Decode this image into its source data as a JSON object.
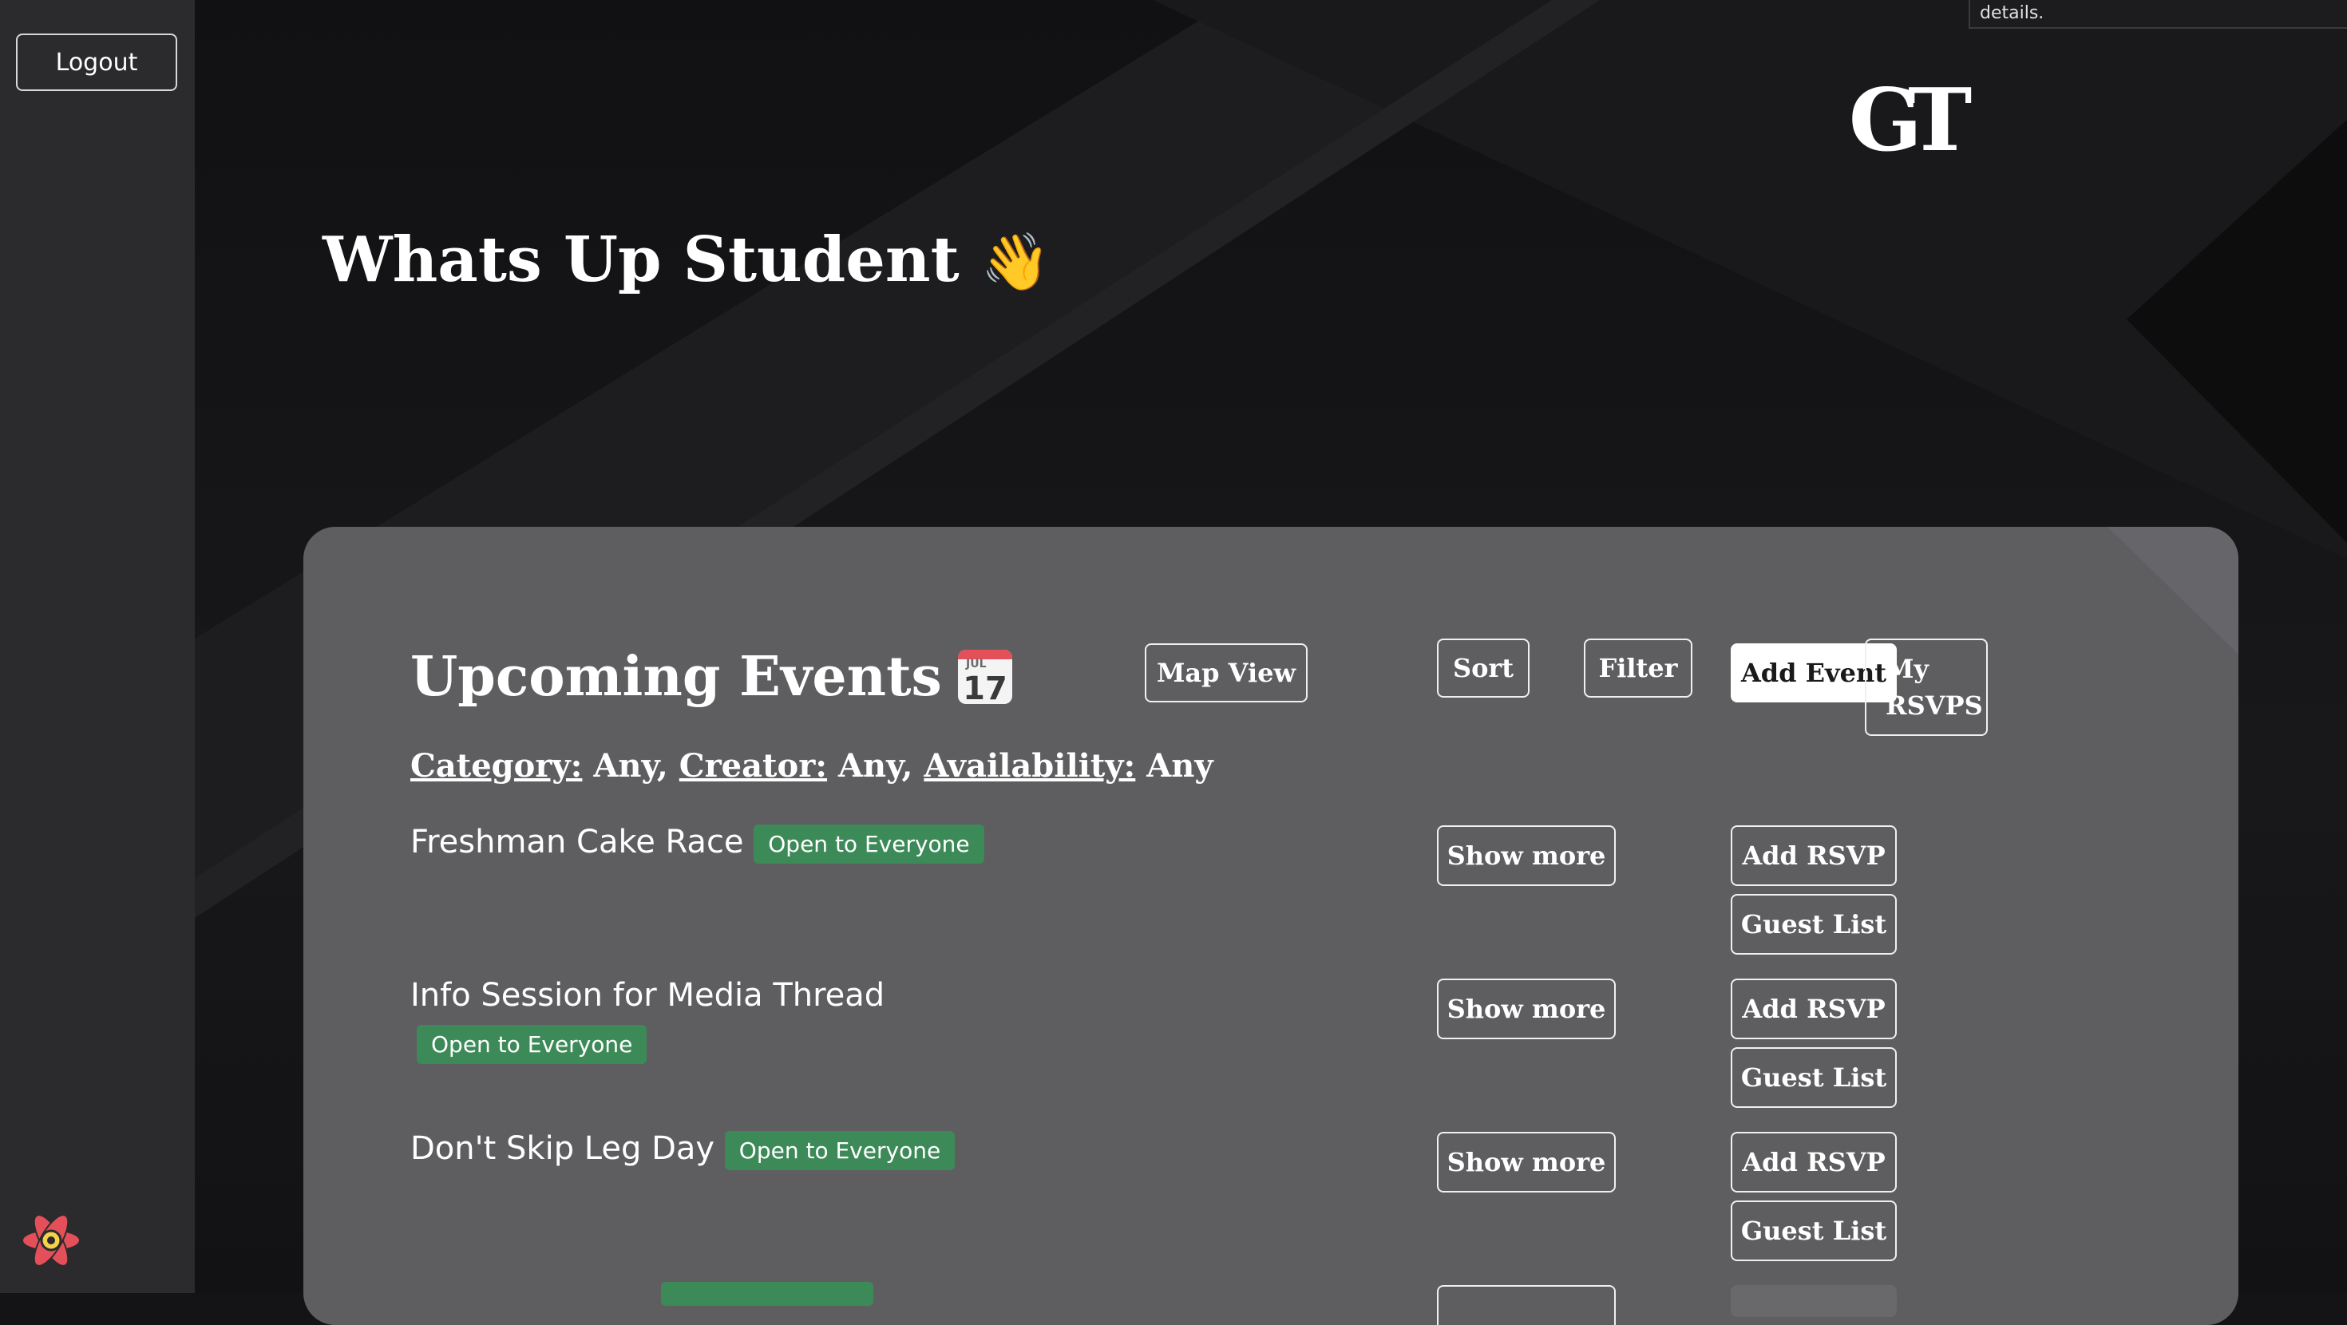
{
  "sidebar": {
    "logout_label": "Logout"
  },
  "tooltip": {
    "text": "details."
  },
  "header": {
    "greeting": "Whats Up Student",
    "greeting_emoji": "👋",
    "logo_text": "GT"
  },
  "events_panel": {
    "title": "Upcoming Events",
    "calendar_month": "JUL",
    "calendar_day": "17",
    "toolbar": {
      "map_view": "Map View",
      "sort": "Sort",
      "filter": "Filter",
      "add_event": "Add Event",
      "my_rsvps_line1": "My",
      "my_rsvps_line2": "RSVPS"
    },
    "filters": {
      "category_label": "Category:",
      "category_value": "Any,",
      "creator_label": "Creator:",
      "creator_value": "Any,",
      "availability_label": "Availability:",
      "availability_value": "Any"
    },
    "events": [
      {
        "name": "Freshman Cake Race",
        "badge": "Open to Everyone",
        "show_more": "Show more",
        "add_rsvp": "Add RSVP",
        "guest_list": "Guest List"
      },
      {
        "name": "Info Session for Media Thread",
        "badge": "Open to Everyone",
        "show_more": "Show more",
        "add_rsvp": "Add RSVP",
        "guest_list": "Guest List"
      },
      {
        "name": "Don't Skip Leg Day",
        "badge": "Open to Everyone",
        "show_more": "Show more",
        "add_rsvp": "Add RSVP",
        "guest_list": "Guest List"
      }
    ]
  },
  "colors": {
    "badge_green": "#3d8a59",
    "panel_gray": "#5e5e61",
    "background_dark": "#141416",
    "sidebar_gray": "#2b2b2d",
    "react_icon": "#e4505a"
  }
}
